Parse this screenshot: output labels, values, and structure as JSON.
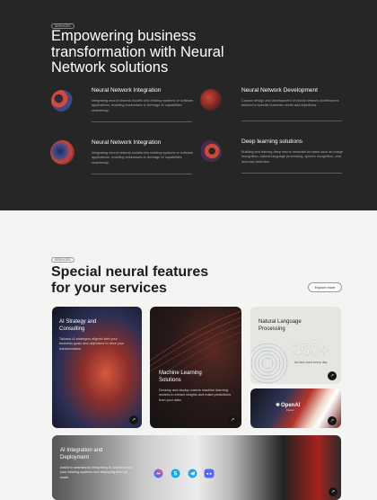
{
  "hero": {
    "tag": "SERVICES",
    "title": "Empowering business transformation with Neural Network solutions",
    "services": [
      {
        "title": "Neural Network Integration",
        "desc": "Integrating neural network models into existing systems or software applications, enabling businesses to leverage AI capabilities seamlessly.",
        "icon": "neural-ring-icon"
      },
      {
        "title": "Neural Network Development",
        "desc": "Custom design and development of neural network architectures tailored to specific business needs and objectives.",
        "icon": "neural-sphere-icon"
      },
      {
        "title": "Neural Network Integration",
        "desc": "Integrating neural network models into existing systems or software applications, enabling businesses to leverage AI capabilities seamlessly.",
        "icon": "neural-globe-icon"
      },
      {
        "title": "Deep learning solutions",
        "desc": "Building and training deep neural networks for tasks such as image recognition, natural language processing, speech recognition, and anomaly detection.",
        "icon": "neural-torus-icon"
      }
    ]
  },
  "features": {
    "tag": "SERVICES",
    "title": "Special neural features for your services",
    "explore_label": "Explore more",
    "cards": {
      "ai_strategy": {
        "title": "AI Strategy and Consulting",
        "desc": "Tailored AI strategies aligned with your business goals and objectives to drive your transformation."
      },
      "ml_solutions": {
        "title": "Machine Learning Solutions",
        "desc": "Develop and deploy custom machine learning models to extract insights and make predictions from your data."
      },
      "nlp": {
        "title": "Natural Language Processing",
        "stat": "250+",
        "stat_label": "Ad last used every day"
      },
      "openai": {
        "brand": "OpenAI",
        "sub": "Partner"
      },
      "integration": {
        "title": "AI Integration and Deployment",
        "desc": "Assist in seamlessly integrating AI solutions into your existing systems and deploying them at scale."
      }
    },
    "apps": [
      "messenger-icon",
      "skype-icon",
      "telegram-icon",
      "discord-icon"
    ]
  },
  "colors": {
    "dark_bg": "#262626",
    "light_bg": "#f4f4f3",
    "accent_red": "#d7583f",
    "accent_blue": "#2d2f55"
  }
}
